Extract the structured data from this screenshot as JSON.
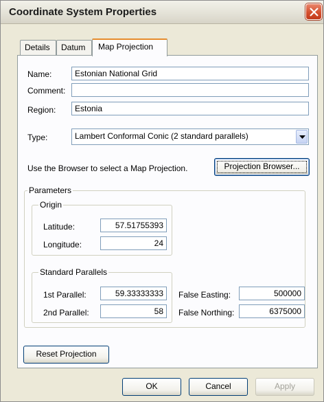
{
  "window": {
    "title": "Coordinate System Properties"
  },
  "tabs": [
    "Details",
    "Datum",
    "Map Projection"
  ],
  "active_tab": "Map Projection",
  "fields": {
    "name": {
      "label": "Name:",
      "value": "Estonian National Grid"
    },
    "comment": {
      "label": "Comment:",
      "value": ""
    },
    "region": {
      "label": "Region:",
      "value": "Estonia"
    },
    "type": {
      "label": "Type:",
      "value": "Lambert Conformal Conic (2 standard parallels)"
    }
  },
  "browser": {
    "hint": "Use the Browser to select a Map Projection.",
    "button": "Projection Browser..."
  },
  "parameters": {
    "title": "Parameters",
    "origin": {
      "title": "Origin",
      "latitude_label": "Latitude:",
      "latitude": "57.51755393",
      "longitude_label": "Longitude:",
      "longitude": "24"
    },
    "standard_parallels": {
      "title": "Standard Parallels",
      "first_label": "1st Parallel:",
      "first": "59.33333333",
      "second_label": "2nd Parallel:",
      "second": "58"
    },
    "false_easting_label": "False Easting:",
    "false_easting": "500000",
    "false_northing_label": "False Northing:",
    "false_northing": "6375000"
  },
  "reset_button": "Reset Projection",
  "footer": {
    "ok": "OK",
    "cancel": "Cancel",
    "apply": "Apply"
  }
}
